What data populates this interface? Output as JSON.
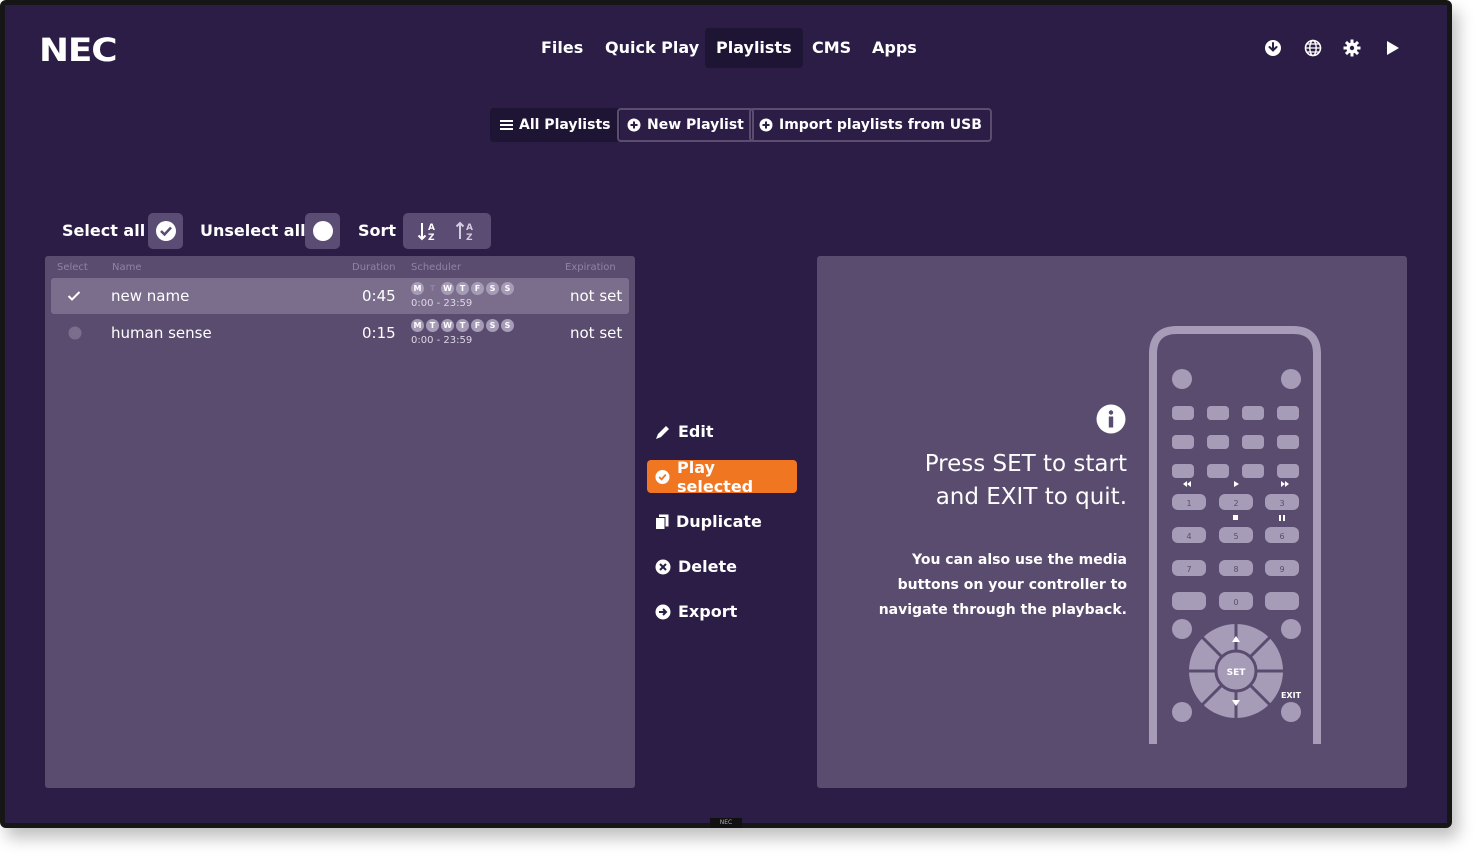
{
  "brand": {
    "logo_text": "NEC",
    "bezel_text": "NEC"
  },
  "nav": {
    "items": [
      "Files",
      "Quick Play",
      "Playlists",
      "CMS",
      "Apps"
    ],
    "active": "Playlists"
  },
  "top_icons": [
    "download-icon",
    "globe-icon",
    "gear-icon",
    "play-icon"
  ],
  "subnav": {
    "all_playlists": "All Playlists",
    "new_playlist": "New Playlist",
    "import": "Import playlists from USB"
  },
  "toolbar": {
    "select_all": "Select all",
    "unselect_all": "Unselect all",
    "sort": "Sort"
  },
  "table": {
    "headers": {
      "select": "Select",
      "name": "Name",
      "duration": "Duration",
      "scheduler": "Scheduler",
      "expiration": "Expiration"
    },
    "rows": [
      {
        "selected": true,
        "name": "new name",
        "duration": "0:45",
        "days": [
          "M",
          "T",
          "W",
          "T",
          "F",
          "S",
          "S"
        ],
        "days_active": [
          true,
          false,
          true,
          true,
          true,
          true,
          true
        ],
        "hours": "0:00 - 23:59",
        "expiration": "not set"
      },
      {
        "selected": false,
        "name": "human sense",
        "duration": "0:15",
        "days": [
          "M",
          "T",
          "W",
          "T",
          "F",
          "S",
          "S"
        ],
        "days_active": [
          true,
          true,
          true,
          true,
          true,
          true,
          true
        ],
        "hours": "0:00 - 23:59",
        "expiration": "not set"
      }
    ]
  },
  "actions": {
    "edit": "Edit",
    "play_selected": "Play selected",
    "duplicate": "Duplicate",
    "delete": "Delete",
    "export": "Export"
  },
  "info": {
    "line1": "Press SET to start",
    "line2": "and EXIT to quit.",
    "sub1": "You can also use the media",
    "sub2": "buttons on your controller to",
    "sub3": "navigate through the playback."
  },
  "remote": {
    "keys_row1": [
      "1",
      "2",
      "3"
    ],
    "keys_row2": [
      "4",
      "5",
      "6"
    ],
    "keys_row3": [
      "7",
      "8",
      "9"
    ],
    "keys_row4": [
      "0"
    ],
    "set_label": "SET",
    "exit_label": "EXIT"
  },
  "colors": {
    "background": "#2b1d45",
    "panel": "#5a4c6e",
    "accent": "#f07622",
    "active_nav": "#1e1433"
  }
}
